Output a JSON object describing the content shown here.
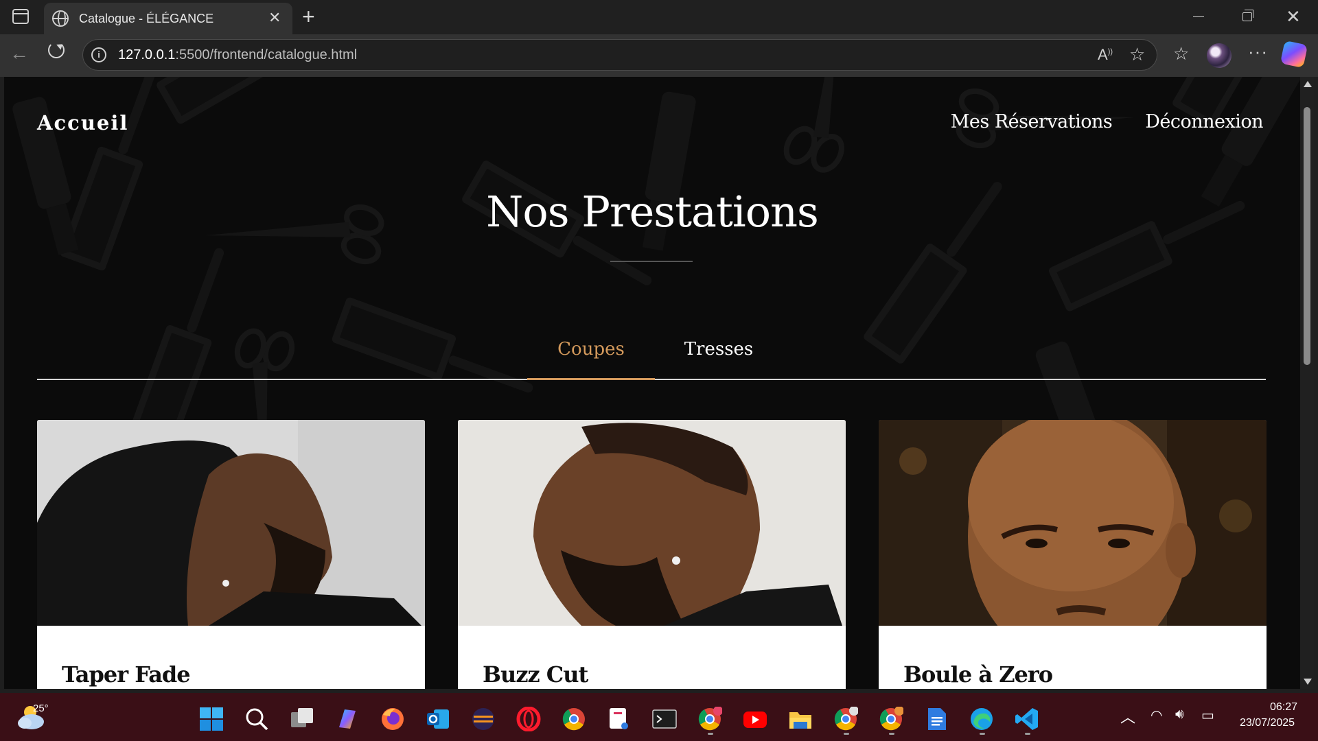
{
  "browser": {
    "tab_title": "Catalogue - ÉLÉGANCE",
    "url_host": "127.0.0.1",
    "url_path": ":5500/frontend/catalogue.html"
  },
  "site": {
    "nav_home": "Accueil",
    "nav_links": [
      "Mes Réservations",
      "Déconnexion"
    ],
    "hero_title": "Nos Prestations",
    "tabs": [
      {
        "label": "Coupes",
        "active": true
      },
      {
        "label": "Tresses",
        "active": false
      }
    ],
    "accent_color": "#d49a5c",
    "cards": [
      {
        "title": "Taper Fade"
      },
      {
        "title": "Buzz Cut"
      },
      {
        "title": "Boule à Zero"
      }
    ]
  },
  "taskbar": {
    "weather_temp": "25°",
    "time": "06:27",
    "date": "23/07/2025",
    "pinned_apps": [
      "windows-start",
      "search",
      "task-view",
      "copilot",
      "firefox",
      "outlook",
      "eclipse",
      "opera",
      "chrome",
      "snipping-tool",
      "terminal",
      "chrome-profile",
      "youtube",
      "file-explorer",
      "chrome-profile-2",
      "chrome-profile-3",
      "google-docs",
      "edge",
      "vscode"
    ]
  }
}
